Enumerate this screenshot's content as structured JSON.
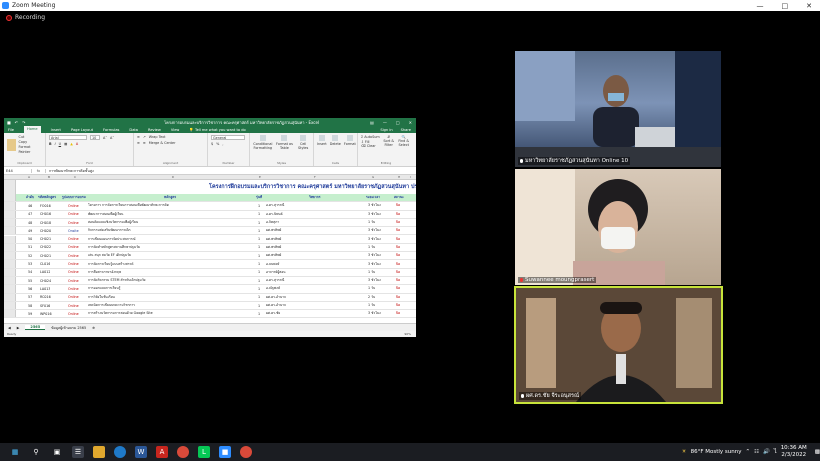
{
  "zoom": {
    "window_title": "Zoom Meeting",
    "recording_label": "Recording"
  },
  "excel": {
    "title": "โครงการอบรมและบริการวิชาการ คณะครุศาสตร์ มหาวิทยาลัยราชภัฏสวนสุนันทา - Excel",
    "signin": "Sign in",
    "share": "Share",
    "tabs": [
      "File",
      "Home",
      "Insert",
      "Page Layout",
      "Formulas",
      "Data",
      "Review",
      "View"
    ],
    "tell_me": "Tell me what you want to do",
    "ribbon": {
      "cut": "Cut",
      "copy": "Copy",
      "format_painter": "Format Painter",
      "font": "Arial",
      "font_size": "10",
      "wrap_text": "Wrap Text",
      "merge": "Merge & Center",
      "number_format": "General",
      "conditional": "Conditional Formatting",
      "format_table": "Format as Table",
      "cell_styles": "Cell Styles",
      "insert": "Insert",
      "delete": "Delete",
      "format": "Format",
      "autosum": "AutoSum",
      "fill": "Fill",
      "clear": "Clear",
      "sort": "Sort & Filter",
      "find": "Find & Select",
      "groups": [
        "Clipboard",
        "Font",
        "Alignment",
        "Number",
        "Styles",
        "Cells",
        "Editing"
      ]
    },
    "name_box": "E44",
    "formula": "การพัฒนาทักษะการคิดขั้นสูง",
    "col_letters": [
      "A",
      "B",
      "C",
      "D",
      "E",
      "F",
      "G",
      "H",
      "I"
    ],
    "banner": "โครงการฝึกอบรมและบริการวิชาการ คณะครุศาสตร์ มหาวิทยาลัยราชภัฏสวนสุนันทา ประจำ",
    "headers": [
      "ลำดับ",
      "รหัสหลักสูตร",
      "รูปแบบการอบรม",
      "หลักสูตร",
      "รุ่นที่",
      "วิทยากร",
      "ระยะเวลา",
      "สถานะ"
    ],
    "rows": [
      {
        "no": "46",
        "code": "FO016",
        "mode": "Online",
        "course": "โครงการ การจัดการเรียนการสอนเพื่อพัฒนาทักษะการคิด",
        "gen": "1",
        "trainer": "อ.ดร.สุวรรณี",
        "hours": "3 ชั่วโมง",
        "status": "ปิด"
      },
      {
        "no": "47",
        "code": "CH016",
        "mode": "Online",
        "course": "พัฒนาการสอนเพื่อผู้เรียน",
        "gen": "1",
        "trainer": "อ.ดร.นิพนธ์",
        "hours": "3 ชั่วโมง",
        "status": "ปิด"
      },
      {
        "no": "48",
        "code": "CH018",
        "mode": "Online",
        "course": "สอนคิดแบบเชิงนวัตกรรมเพื่อผู้เรียน",
        "gen": "1",
        "trainer": "อ.จิตสุภา",
        "hours": "1 วัน",
        "status": "ปิด"
      },
      {
        "no": "49",
        "code": "CH020",
        "mode": "Onsite",
        "course": "กิจกรรมส่งเสริมพัฒนาการเด็ก",
        "gen": "1",
        "trainer": "ผศ.พรทิพย์",
        "hours": "3 ชั่วโมง",
        "status": "ปิด"
      },
      {
        "no": "50",
        "code": "CH021",
        "mode": "Online",
        "course": "การเขียนแผนการจัดประสบการณ์",
        "gen": "1",
        "trainer": "ผศ.พรทิพย์",
        "hours": "3 ชั่วโมง",
        "status": "ปิด"
      },
      {
        "no": "51",
        "code": "CH022",
        "mode": "Online",
        "course": "การจัดทำหลักสูตรสถานศึกษาปฐมวัย",
        "gen": "1",
        "trainer": "ผศ.พรทิพย์",
        "hours": "1 วัน",
        "status": "ปิด"
      },
      {
        "no": "52",
        "code": "CH021",
        "mode": "Online",
        "course": "เล่น สนุก สมวัย EF เด็กปฐมวัย",
        "gen": "1",
        "trainer": "ผศ.พรทิพย์",
        "hours": "3 ชั่วโมง",
        "status": "ปิด"
      },
      {
        "no": "53",
        "code": "CL016",
        "mode": "Online",
        "course": "การจัดการเรียนรู้แบบสร้างสรรค์",
        "gen": "1",
        "trainer": "อ.ธนพงษ์",
        "hours": "3 ชั่วโมง",
        "status": "ปิด"
      },
      {
        "no": "54",
        "code": "LA012",
        "mode": "Online",
        "course": "การสื่อสารภาษาอังกฤษ",
        "gen": "1",
        "trainer": "อาจารย์ผู้สอน",
        "hours": "1 วัน",
        "status": "ปิด"
      },
      {
        "no": "55",
        "code": "CH024",
        "mode": "Online",
        "course": "การจัดกิจกรรม STEM สำหรับเด็กปฐมวัย",
        "gen": "1",
        "trainer": "อ.ดร.สุวรรณี",
        "hours": "3 ชั่วโมง",
        "status": "ปิด"
      },
      {
        "no": "56",
        "code": "LA013",
        "mode": "Online",
        "course": "การออกแบบการเรียนรู้",
        "gen": "1",
        "trainer": "อ.ณัฐพงษ์",
        "hours": "1 วัน",
        "status": "ปิด"
      },
      {
        "no": "57",
        "code": "RC016",
        "mode": "Online",
        "course": "การวิจัยในชั้นเรียน",
        "gen": "1",
        "trainer": "ผศ.ดร.อำนาจ",
        "hours": "2 วัน",
        "status": "ปิด"
      },
      {
        "no": "58",
        "code": "SF016",
        "mode": "Online",
        "course": "เทคนิคการเขียนบทความวิชาการ",
        "gen": "1",
        "trainer": "ผศ.ดร.อำนาจ",
        "hours": "1 วัน",
        "status": "ปิด"
      },
      {
        "no": "59",
        "code": "WP016",
        "mode": "Online",
        "course": "การสร้างนวัตกรรมการสอนด้วย Google Site",
        "gen": "1",
        "trainer": "ผศ.ดร.ชัย",
        "hours": "3 ชั่วโมง",
        "status": "ปิด"
      }
    ],
    "sheet_tabs": [
      "2565",
      "ข้อมูลผู้เข้าอบรม 2565"
    ],
    "status_left": "Ready",
    "zoom_level": "90%"
  },
  "participants": [
    {
      "name": "มหาวิทยาลัยราชภัฏสวนสุนันทา Online 10"
    },
    {
      "name": "Suwannee moungprasert"
    },
    {
      "name": "ผศ.ดร.ชัย จีระอนุสรณ์"
    }
  ],
  "taskbar": {
    "weather": "86°F  Mostly sunny",
    "time": "10:36 AM",
    "date": "2/3/2022"
  },
  "colors": {
    "excel_green": "#217346",
    "active_speaker": "#c7e33a",
    "online_red": "#c00000"
  }
}
